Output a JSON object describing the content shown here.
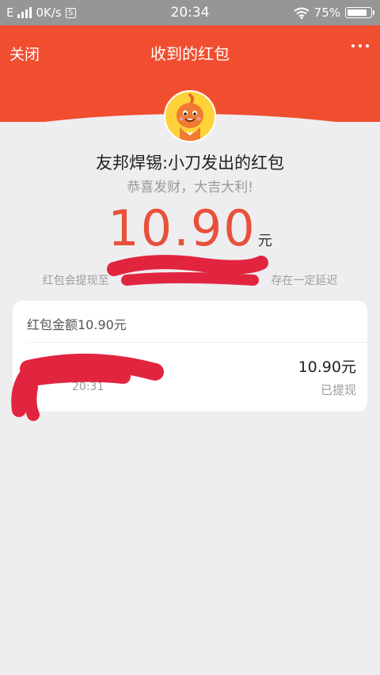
{
  "status_bar": {
    "network": "E",
    "speed": "0K/s",
    "sim_badge": "S",
    "time": "20:34",
    "battery": "75%"
  },
  "nav": {
    "close_label": "关闭",
    "title": "收到的红包"
  },
  "envelope": {
    "sender_line": "友邦焊锡:小刀发出的红包",
    "wish": "恭喜发财，大吉大利!",
    "amount": "10.90",
    "unit": "元",
    "note": "红包会提现至                                              存在一定延迟"
  },
  "card": {
    "title": "红包金额10.90元",
    "record": {
      "time": "20:31",
      "amount": "10.90元",
      "status": "已提现"
    }
  },
  "colors": {
    "brand_red": "#f04e2f",
    "amount_red": "#e8503a",
    "redaction_red": "#e2253f",
    "status_bar": "#969696",
    "background": "#eeedf0"
  }
}
